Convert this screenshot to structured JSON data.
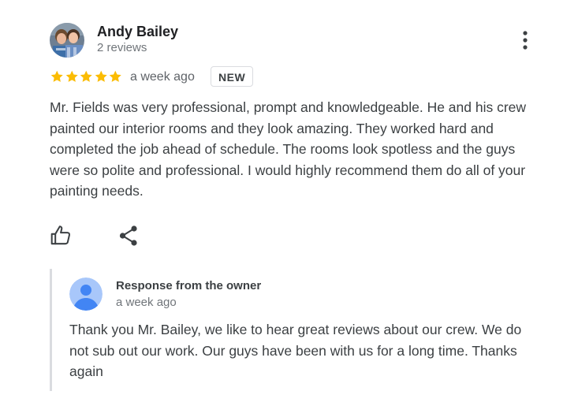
{
  "review": {
    "reviewer_name": "Andy Bailey",
    "reviewer_reviews": "2 reviews",
    "rating": 5,
    "rating_max": 5,
    "time": "a week ago",
    "badge": "NEW",
    "text": "Mr. Fields was very professional, prompt and knowledgeable. He and his crew painted our interior rooms and they look amazing. They worked hard and completed the job ahead of schedule. The rooms look spotless and the guys were so polite and professional. I would highly recommend them do all of your painting needs."
  },
  "owner_response": {
    "title": "Response from the owner",
    "time": "a week ago",
    "text": "Thank you Mr. Bailey, we like to hear great reviews about our crew. We do not sub out our work. Our guys have been with us for a long time. Thanks again"
  },
  "icons": {
    "more_menu": "more-vert-icon",
    "like": "thumb-up-icon",
    "share": "share-icon",
    "owner_avatar": "person-icon",
    "star": "star-icon"
  },
  "colors": {
    "star": "#fbbc04",
    "text_primary": "#202124",
    "text_body": "#3c4043",
    "text_secondary": "#70757a",
    "owner_avatar_bg": "#a8c7fa",
    "owner_avatar_fg": "#4285f4",
    "divider": "#dadce0"
  }
}
